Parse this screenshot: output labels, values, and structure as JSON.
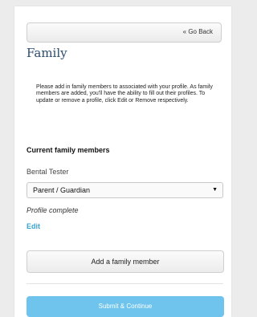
{
  "header": {
    "back_label": "« Go Back",
    "title": "Family"
  },
  "intro": {
    "text": "Please add in family members to associated with your profile. As family members are added, you'll have the ability to fill out their profiles. To update or remove a profile, click Edit or Remove respectively."
  },
  "members_section": {
    "title": "Current family members",
    "members": [
      {
        "name": "Bental Tester",
        "role_selected": "Parent / Guardian",
        "status": "Profile complete",
        "edit_label": "Edit"
      }
    ]
  },
  "actions": {
    "add_label": "Add a family member",
    "submit_label": "Submit & Continue"
  },
  "colors": {
    "title": "#2b4c6f",
    "link": "#37a6d1",
    "submit_bg": "#6ec4ec"
  }
}
